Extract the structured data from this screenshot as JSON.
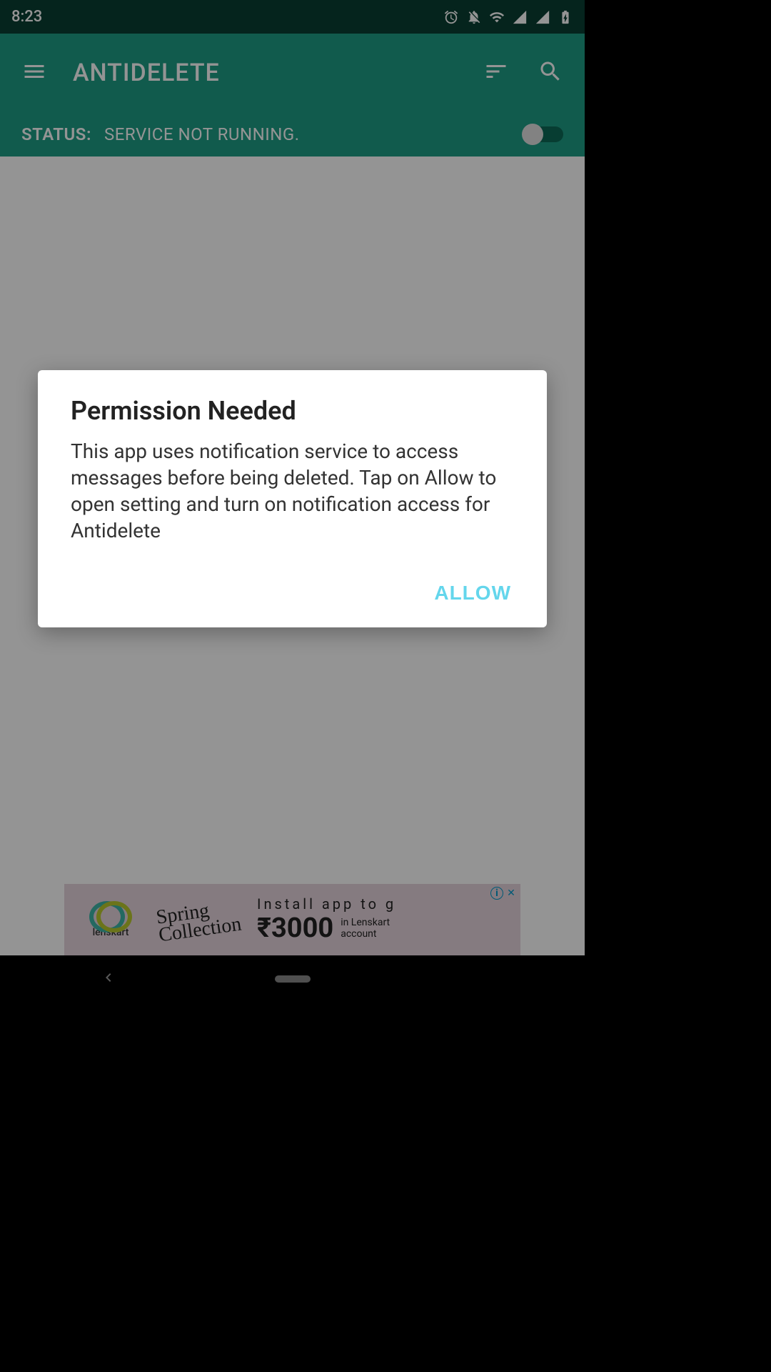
{
  "statusbar": {
    "time": "8:23"
  },
  "header": {
    "title": "ANTIDELETE"
  },
  "status": {
    "label": "STATUS:",
    "value": "SERVICE NOT RUNNING."
  },
  "ad": {
    "brand": "lenskart",
    "script1": "Spring",
    "script2": "Collection",
    "install": "Install app to g",
    "price": "₹3000",
    "sub1": "in Lenskart",
    "sub2": "account",
    "info": "i",
    "close": "✕"
  },
  "dialog": {
    "title": "Permission Needed",
    "body": "This app uses notification service to access messages before being deleted. Tap on Allow to open setting and turn on notification access for Antidelete",
    "allow": "ALLOW"
  }
}
